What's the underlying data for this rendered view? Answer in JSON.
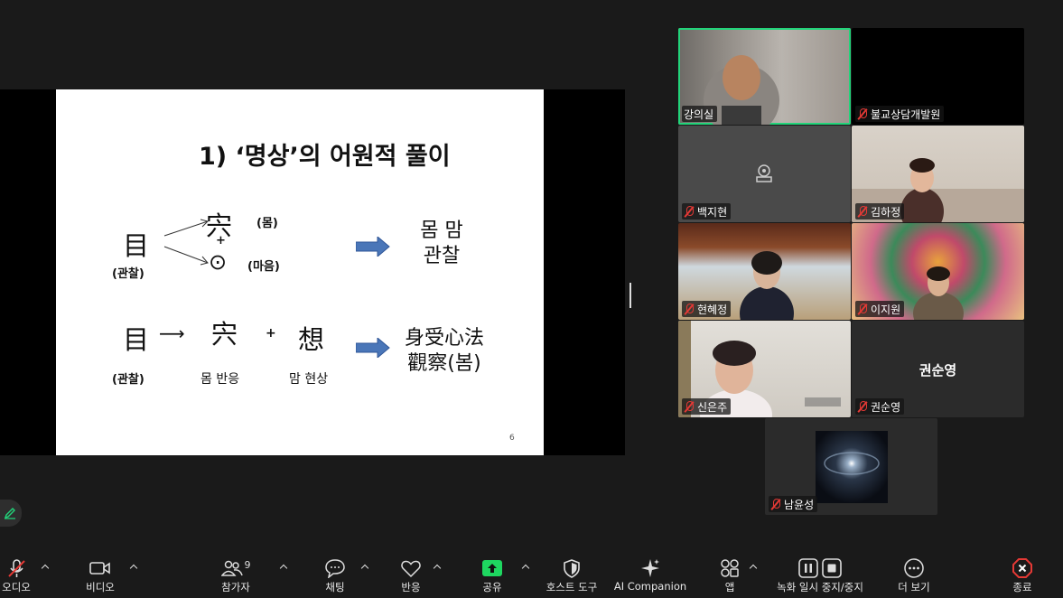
{
  "slide": {
    "title": "1) ‘명상’의 어원적  풀이",
    "row1": {
      "char_main": "目",
      "label_main": "(관찰)",
      "char_top": "宍",
      "paren_top": "(몸)",
      "plus": "+",
      "char_bottom": "⊙",
      "paren_bottom": "(마음)",
      "result_line1": "몸 맘",
      "result_line2": "관찰"
    },
    "row2": {
      "char_main": "目",
      "label_main": "(관찰)",
      "arrow": "⟶",
      "char_a": "宍",
      "label_a": "몸 반응",
      "plus": "+",
      "char_b": "想",
      "label_b": "맘 현상",
      "result_line1": "身受心法",
      "result_line2": "觀察(봄)"
    },
    "page_number": "6"
  },
  "participants": [
    {
      "name": "강의실",
      "muted": false
    },
    {
      "name": "불교상담개발원",
      "muted": true
    },
    {
      "name": "백지현",
      "muted": true
    },
    {
      "name": "김하정",
      "muted": true
    },
    {
      "name": "현혜정",
      "muted": true
    },
    {
      "name": "이지원",
      "muted": true
    },
    {
      "name": "신은주",
      "muted": true
    },
    {
      "name": "권순영",
      "muted": true,
      "center_label": "권순영"
    },
    {
      "name": "남윤성",
      "muted": true
    }
  ],
  "toolbar": {
    "audio": "오디오",
    "video": "비디오",
    "participants": "참가자",
    "participants_count": "9",
    "chat": "채팅",
    "reactions": "반응",
    "share": "공유",
    "host_tools": "호스트 도구",
    "ai_companion": "AI Companion",
    "apps": "앱",
    "recording": "녹화 일시 중지/중지",
    "more": "더 보기",
    "end": "종료"
  },
  "colors": {
    "active_speaker": "#22d47a",
    "share_green": "#1ed760",
    "end_red": "#e53935",
    "slide_arrow": "#4a76b8"
  }
}
